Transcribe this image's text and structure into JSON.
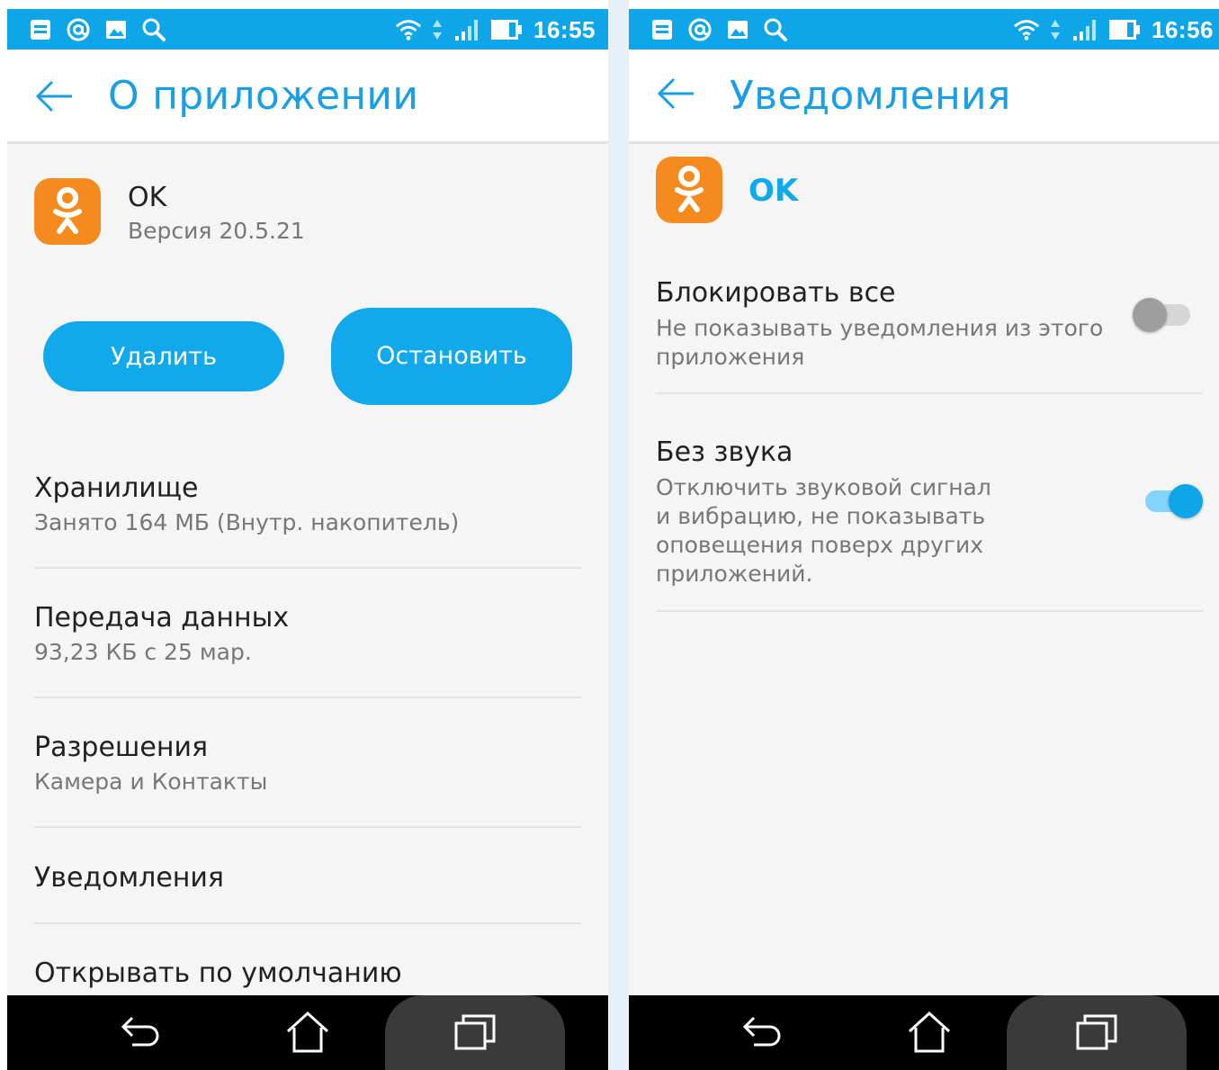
{
  "left_screen": {
    "status": {
      "time": "16:55"
    },
    "title": "О приложении",
    "app": {
      "name": "OK",
      "version": "Версия 20.5.21"
    },
    "buttons": {
      "delete": "Удалить",
      "stop": "Остановить"
    },
    "items": [
      {
        "title": "Хранилище",
        "subtitle": "Занято 164 МБ (Внутр. накопитель)"
      },
      {
        "title": "Передача данных",
        "subtitle": "93,23 КБ с 25 мар."
      },
      {
        "title": "Разрешения",
        "subtitle": "Камера и Контакты"
      },
      {
        "title": "Уведомления",
        "subtitle": ""
      },
      {
        "title": "Открывать по умолчанию",
        "subtitle": ""
      }
    ]
  },
  "right_screen": {
    "status": {
      "time": "16:56"
    },
    "title": "Уведомления",
    "app": {
      "name": "OK"
    },
    "settings": [
      {
        "title": "Блокировать все",
        "subtitle": "Не показывать уведомления из этого приложения",
        "enabled": false
      },
      {
        "title": "Без звука",
        "subtitle": "Отключить звуковой сигнал и вибрацию, не показывать оповещения поверх других приложений.",
        "enabled": true
      }
    ]
  },
  "icons": {
    "status_left": [
      "notes-icon",
      "at-sign-icon",
      "image-icon",
      "search-icon"
    ],
    "status_right": [
      "wifi-icon",
      "data-arrows-icon",
      "signal-icon",
      "battery-icon"
    ],
    "nav": [
      "back-nav-icon",
      "home-nav-icon",
      "recent-apps-icon"
    ]
  },
  "colors": {
    "status_bar": "#0ea5e9",
    "accent": "#12a8ec",
    "title_text": "#1a9ee6",
    "ok_brand": "#f58a1f",
    "toggle_on_thumb": "#0ea5e9",
    "toggle_off_thumb": "#9e9e9e"
  }
}
